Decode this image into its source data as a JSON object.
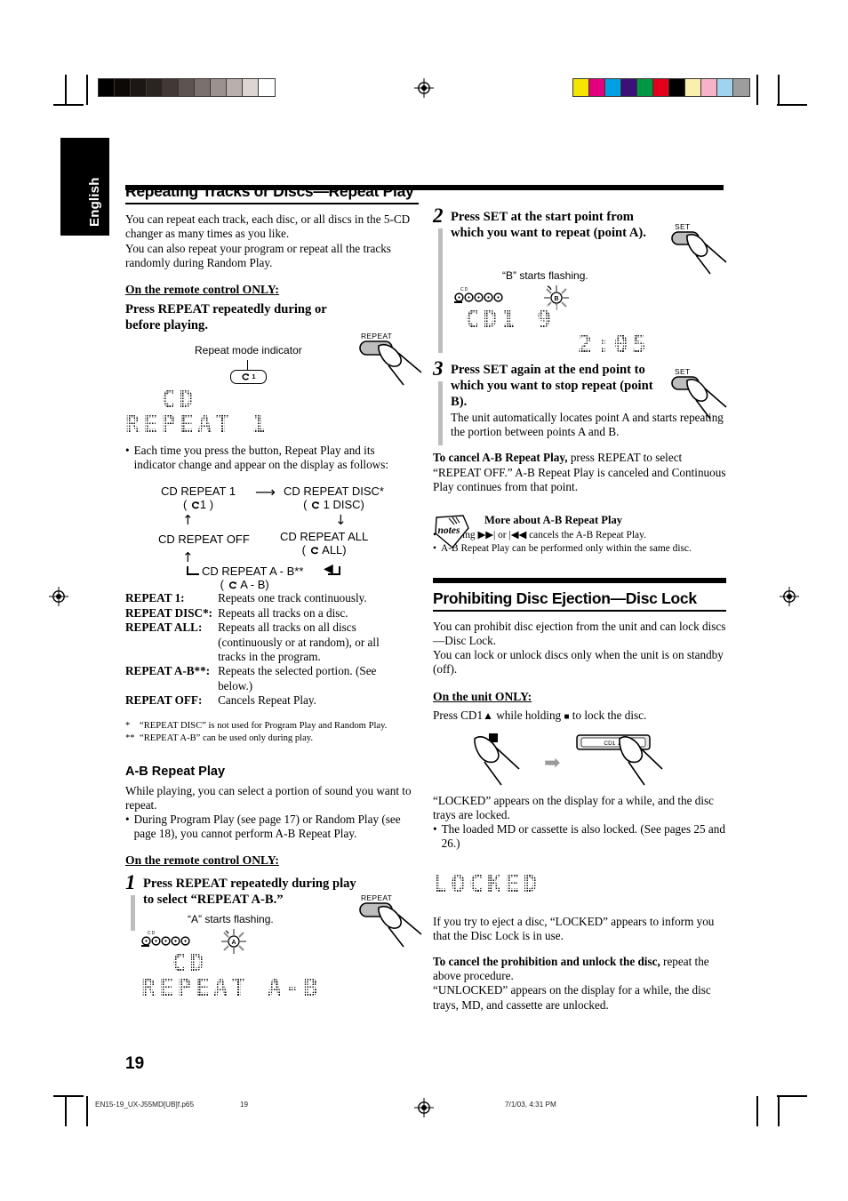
{
  "page": {
    "language_tab": "English",
    "page_number": "19",
    "footer_file": "EN15-19_UX-J55MD[UB]f.p65",
    "footer_page": "19",
    "footer_date": "7/1/03, 4:31 PM"
  },
  "colors": {
    "gray_wedge": [
      "#000000",
      "#0d0907",
      "#1d1714",
      "#2b2421",
      "#413936",
      "#5d5450",
      "#7a716d",
      "#9b928e",
      "#b8b0ac",
      "#dcd6d2",
      "#ffffff"
    ],
    "color_bar": [
      "#f5e400",
      "#e2007f",
      "#00a0e3",
      "#3b1178",
      "#009843",
      "#e3001b",
      "#000000",
      "#faf0ad",
      "#f6b2c8",
      "#9fd3f0",
      "#9d9d9d"
    ],
    "step_bar": "#bdbdbd",
    "lcd_text": "#151515"
  },
  "left": {
    "section_title": "Repeating Tracks or Discs—Repeat Play",
    "intro": [
      "You can repeat each track, each disc, or all discs in the 5-CD changer as many times as you like.",
      "You can also repeat your program or repeat all the tracks randomly during Random Play."
    ],
    "remote_only": "On the remote control ONLY:",
    "instruction": "Press REPEAT repeatedly during or before playing.",
    "repeat_button_label": "REPEAT",
    "indicator_caption": "Repeat mode indicator",
    "indicator_glyph": "1",
    "display_line1": "CD",
    "display_line2": "REPEAT 1",
    "bullet_after_display": "Each time you press the button, Repeat Play and its indicator change and appear on the display as follows:",
    "cycle": [
      {
        "name": "CD REPEAT 1",
        "mode": "( 1 )"
      },
      {
        "name": "CD REPEAT DISC*",
        "mode": "( 1 DISC)"
      },
      {
        "name": "CD REPEAT ALL",
        "mode": "( ALL)"
      },
      {
        "name": "CD REPEAT A - B**",
        "mode": "( A - B)"
      },
      {
        "name": "CD REPEAT OFF",
        "mode": ""
      }
    ],
    "definitions": [
      {
        "key": "REPEAT 1:",
        "value": "Repeats one track continuously."
      },
      {
        "key": "REPEAT DISC*:",
        "value": "Repeats all tracks on a disc."
      },
      {
        "key": "REPEAT ALL:",
        "value": "Repeats all tracks on all discs (continuously or at random), or all tracks in the program."
      },
      {
        "key": "REPEAT A-B**:",
        "value": "Repeats the selected portion. (See below.)"
      },
      {
        "key": "REPEAT OFF:",
        "value": "Cancels Repeat Play."
      }
    ],
    "footnotes": [
      {
        "mark": "*",
        "text": "“REPEAT DISC” is not used for Program Play and  Random Play."
      },
      {
        "mark": "**",
        "text": "“REPEAT A-B” can be used only during play."
      }
    ],
    "ab_title": "A-B Repeat Play",
    "ab_intro": "While playing, you can select a portion of sound you want to repeat.",
    "ab_bullet": "During Program Play (see page 17) or Random Play (see page 18), you cannot perform A-B Repeat Play.",
    "ab_remote_only": "On the remote control ONLY:",
    "step1_num": "1",
    "step1_text": "Press REPEAT repeatedly during play to select “REPEAT A-B.”",
    "step1_caption": "“A” starts flashing.",
    "step1_flash_letter": "A",
    "step1_display_line1": "CD",
    "step1_display_line2": "REPEAT A-B"
  },
  "right": {
    "step2_num": "2",
    "step2_text": "Press SET at the start point from which you want to repeat (point A).",
    "step2_button_label": "SET",
    "step2_caption": "“B” starts flashing.",
    "step2_flash_letter": "B",
    "step2_display_line1": "CD1  9",
    "step2_display_line2": "2:05",
    "step3_num": "3",
    "step3_text": "Press SET again at the end point to which you want to stop repeat (point B).",
    "step3_button_label": "SET",
    "step3_body": "The unit automatically locates point A and starts repeating the portion between points A and B.",
    "cancel_bold": "To cancel A-B Repeat Play,",
    "cancel_rest": " press REPEAT to select “REPEAT OFF.” A-B Repeat Play is canceled and Continuous Play continues from that point.",
    "notes_icon_label": "notes",
    "notes_title": "More about A-B Repeat Play",
    "notes": [
      "Pressing ▶▶| or |◀◀ cancels the A-B Repeat Play.",
      "A-B Repeat Play can be performed only within the same disc."
    ],
    "disc_lock_title": "Prohibiting Disc Ejection—Disc Lock",
    "disc_lock_intro": [
      "You can prohibit disc ejection from the unit and can lock discs—Disc Lock.",
      "You can lock or unlock discs only when the unit is on standby (off)."
    ],
    "unit_only": "On the unit ONLY:",
    "lock_instruction_pre": "Press CD1",
    "lock_instruction_mid": " while holding ",
    "lock_instruction_post": " to lock the disc.",
    "eject_button_label": "CD1",
    "locked_result": "“LOCKED” appears on the display for a while, and the disc trays are locked.",
    "locked_bullet": "The loaded MD or cassette is also locked. (See pages 25 and 26.)",
    "locked_display": "LOCKED",
    "eject_note": "If you try to eject a disc, “LOCKED” appears to inform you that the Disc Lock is in use.",
    "cancel_lock_bold": "To cancel the prohibition and unlock the disc,",
    "cancel_lock_rest": " repeat the above procedure.",
    "unlocked_note": "“UNLOCKED” appears on the display for a while, the disc trays, MD, and cassette are unlocked."
  }
}
